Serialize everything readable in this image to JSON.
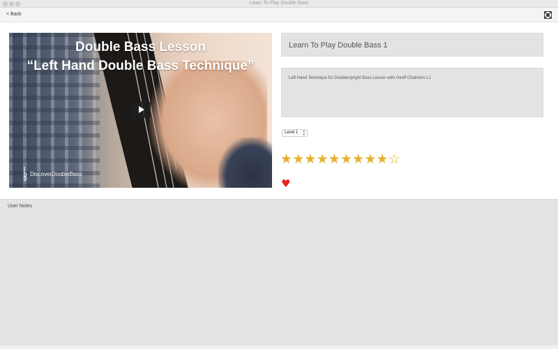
{
  "window": {
    "title": "Learn To Play Double Bass"
  },
  "toolbar": {
    "back_label": "< Back",
    "fullscreen_icon": "fullscreen-icon"
  },
  "video": {
    "title_line1": "Double Bass Lesson",
    "title_line2": "“Left Hand Double Bass Technique”",
    "brand": "DiscoverDoubleBass",
    "play_icon": "play-icon"
  },
  "lesson": {
    "title": "Learn To Play Double Bass 1",
    "description": "Left Hand Technique for DoubleUpright Bass Lesson with Geoff Chalmers L1",
    "level": "Level 1",
    "rating": 9,
    "rating_max": 10,
    "favorite": true,
    "favorite_icon": "heart-icon",
    "star_color": "#e3b12c",
    "heart_color": "#e8221b"
  },
  "notes": {
    "label": "User Notes",
    "value": ""
  }
}
